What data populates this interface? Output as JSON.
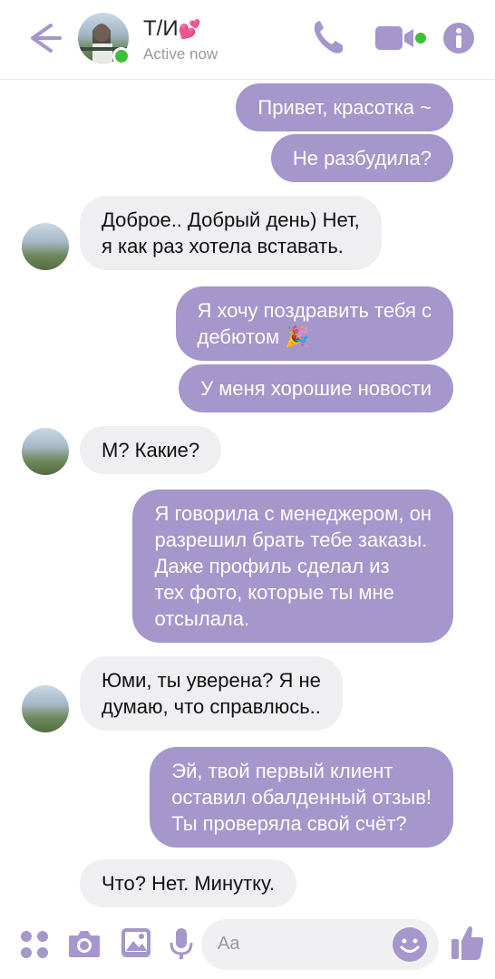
{
  "header": {
    "name": "Т/И",
    "name_emoji": "💕",
    "status": "Active now",
    "icons": [
      "back-arrow-icon",
      "phone-icon",
      "video-icon",
      "info-icon"
    ],
    "accent_color": "#a596cc",
    "online_color": "#3fbe3a"
  },
  "messages": [
    {
      "side": "out",
      "lines": [
        "Привет, красотка ~"
      ]
    },
    {
      "side": "out",
      "lines": [
        "Не разбудила?"
      ]
    },
    {
      "side": "in",
      "lines": [
        "Доброе.. Добрый день) Нет,",
        "я как раз хотела вставать."
      ]
    },
    {
      "side": "out",
      "lines": [
        "Я хочу поздравить тебя с",
        "дебютом 🎉"
      ]
    },
    {
      "side": "out",
      "lines": [
        "У меня хорошие новости"
      ]
    },
    {
      "side": "in",
      "lines": [
        "М? Какие?"
      ]
    },
    {
      "side": "out",
      "lines": [
        "Я говорила с менеджером, он",
        "разрешил брать тебе заказы.",
        "Даже профиль сделал из",
        "тех фото, которые ты мне",
        "отсылала."
      ]
    },
    {
      "side": "in",
      "lines": [
        "Юми, ты уверена? Я не",
        "думаю, что справлюсь.."
      ]
    },
    {
      "side": "out",
      "lines": [
        "Эй, твой первый клиент",
        "оставил обалденный отзыв!",
        "Ты проверяла свой счёт?"
      ]
    },
    {
      "side": "in",
      "lines": [
        "Что? Нет. Минутку."
      ]
    }
  ],
  "composer": {
    "placeholder": "Aa",
    "icons": [
      "apps-icon",
      "camera-icon",
      "image-icon",
      "microphone-icon",
      "emoji-icon",
      "thumbs-up-icon"
    ]
  }
}
